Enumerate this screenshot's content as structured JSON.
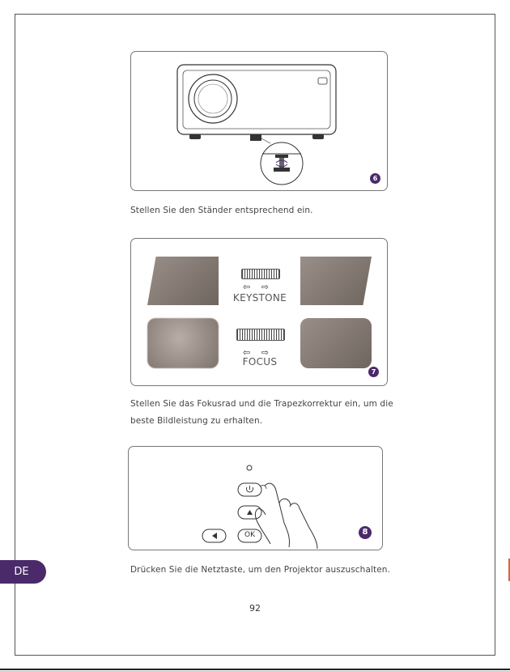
{
  "language_tab": "DE",
  "page_number": "92",
  "steps": [
    {
      "badge": "6",
      "caption": "Stellen Sie den Ständer entsprechend ein."
    },
    {
      "badge": "7",
      "caption_line1": "Stellen Sie das Fokusrad und die Trapezkorrektur ein, um die",
      "caption_line2": "beste Bildleistung zu erhalten."
    },
    {
      "badge": "8",
      "caption": "Drücken Sie die Netztaste, um den Projektor auszuschalten."
    }
  ],
  "figure7": {
    "keystone_label": "KEYSTONE",
    "focus_label": "FOCUS"
  },
  "figure8": {
    "ok_label": "OK"
  },
  "colors": {
    "accent": "#4a2a6a",
    "edge_mark": "#d26a3c"
  }
}
